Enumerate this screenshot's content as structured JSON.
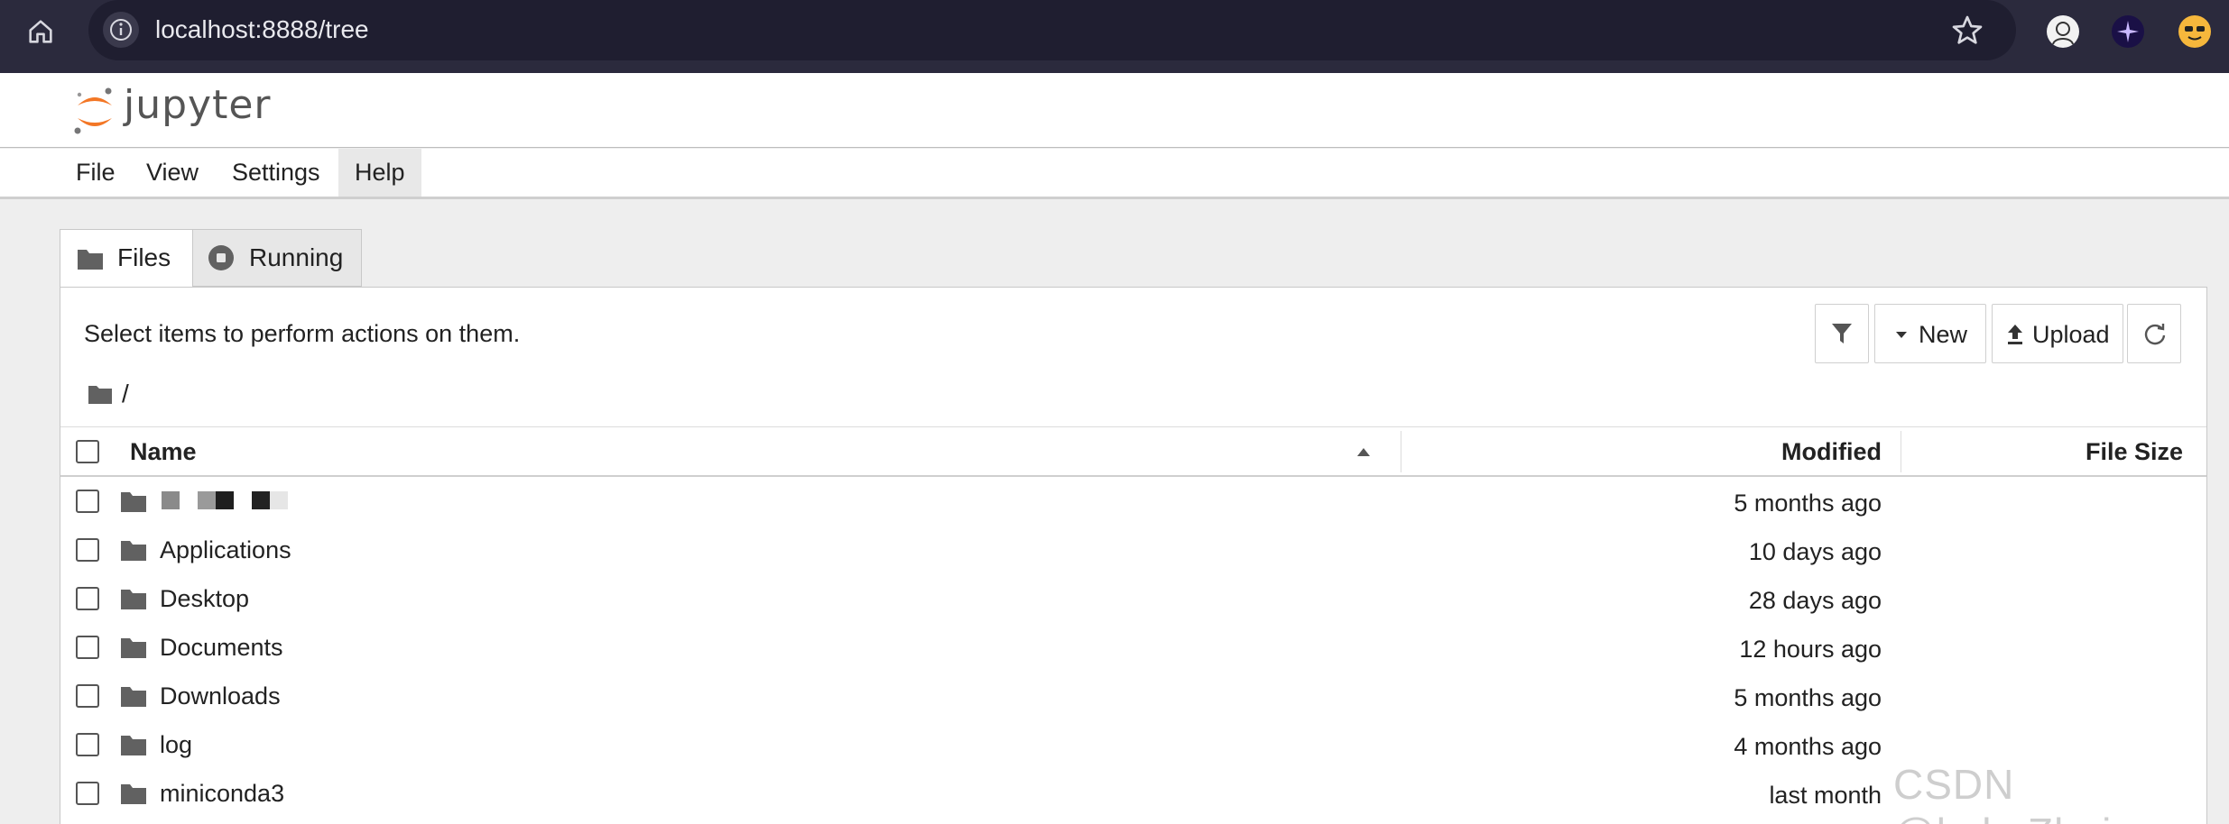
{
  "browser": {
    "url": "localhost:8888/tree"
  },
  "app": {
    "logo_text": "jupyter"
  },
  "menu": [
    {
      "label": "File"
    },
    {
      "label": "View"
    },
    {
      "label": "Settings"
    },
    {
      "label": "Help"
    }
  ],
  "tabs": {
    "files": "Files",
    "running": "Running"
  },
  "toolbar": {
    "hint": "Select items to perform actions on them.",
    "new_label": "New",
    "upload_label": "Upload"
  },
  "breadcrumb": "/",
  "table": {
    "headers": {
      "name": "Name",
      "modified": "Modified",
      "size": "File Size"
    },
    "rows": [
      {
        "name": "",
        "modified": "5 months ago",
        "redacted": true
      },
      {
        "name": "Applications",
        "modified": "10 days ago"
      },
      {
        "name": "Desktop",
        "modified": "28 days ago"
      },
      {
        "name": "Documents",
        "modified": "12 hours ago"
      },
      {
        "name": "Downloads",
        "modified": "5 months ago"
      },
      {
        "name": "log",
        "modified": "4 months ago"
      },
      {
        "name": "miniconda3",
        "modified": "last month"
      }
    ]
  },
  "watermark": "CSDN @kakaZhui",
  "colors": {
    "chrome_bg": "#2b2a3d",
    "jupyter_orange": "#f37726",
    "folder_icon": "#616161"
  }
}
